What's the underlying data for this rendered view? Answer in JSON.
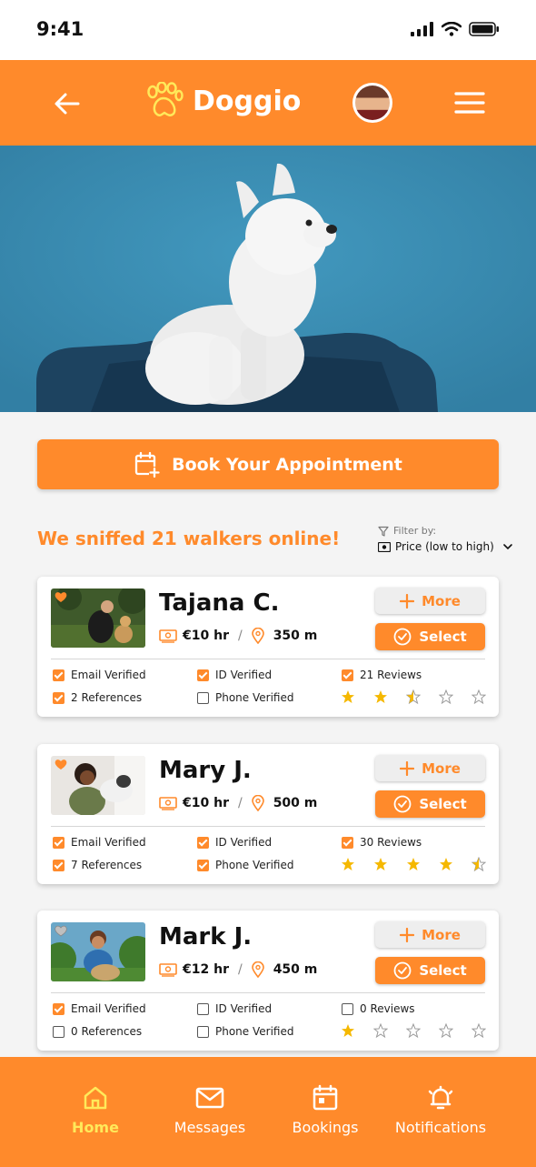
{
  "status": {
    "time": "9:41"
  },
  "header": {
    "title": "Doggio"
  },
  "book_button": {
    "label": "Book Your Appointment"
  },
  "results": {
    "headline": "We sniffed 21 walkers online!"
  },
  "filter": {
    "label": "Filter by:",
    "value": "Price (low to high)"
  },
  "walkers": [
    {
      "name": "Tajana C.",
      "rate": "€10 hr",
      "distance": "350 m",
      "favorite": true,
      "more_label": "More",
      "select_label": "Select",
      "email": "Email Verified",
      "id": "ID Verified",
      "reviews": "21 Reviews",
      "references": "2 References",
      "phone": "Phone Verified",
      "email_checked": true,
      "id_checked": true,
      "reviews_checked": true,
      "references_checked": true,
      "phone_checked": false,
      "rating": 2.5
    },
    {
      "name": "Mary J.",
      "rate": "€10 hr",
      "distance": "500 m",
      "favorite": true,
      "more_label": "More",
      "select_label": "Select",
      "email": "Email Verified",
      "id": "ID Verified",
      "reviews": "30 Reviews",
      "references": "7 References",
      "phone": "Phone Verified",
      "email_checked": true,
      "id_checked": true,
      "reviews_checked": true,
      "references_checked": true,
      "phone_checked": true,
      "rating": 4.5
    },
    {
      "name": "Mark J.",
      "rate": "€12 hr",
      "distance": "450 m",
      "favorite": false,
      "more_label": "More",
      "select_label": "Select",
      "email": "Email Verified",
      "id": "ID Verified",
      "reviews": "0 Reviews",
      "references": "0 References",
      "phone": "Phone Verified",
      "email_checked": true,
      "id_checked": false,
      "reviews_checked": false,
      "references_checked": false,
      "phone_checked": false,
      "rating": 1
    }
  ],
  "tabs": [
    {
      "label": "Home",
      "icon": "home-icon",
      "active": true
    },
    {
      "label": "Messages",
      "icon": "mail-icon",
      "active": false
    },
    {
      "label": "Bookings",
      "icon": "calendar-icon",
      "active": false
    },
    {
      "label": "Notifications",
      "icon": "bell-icon",
      "active": false
    }
  ],
  "colors": {
    "brand": "#ff8a2b",
    "active_tab": "#ffe95a",
    "star": "#f5b800",
    "hero": "#3a8fb5"
  }
}
